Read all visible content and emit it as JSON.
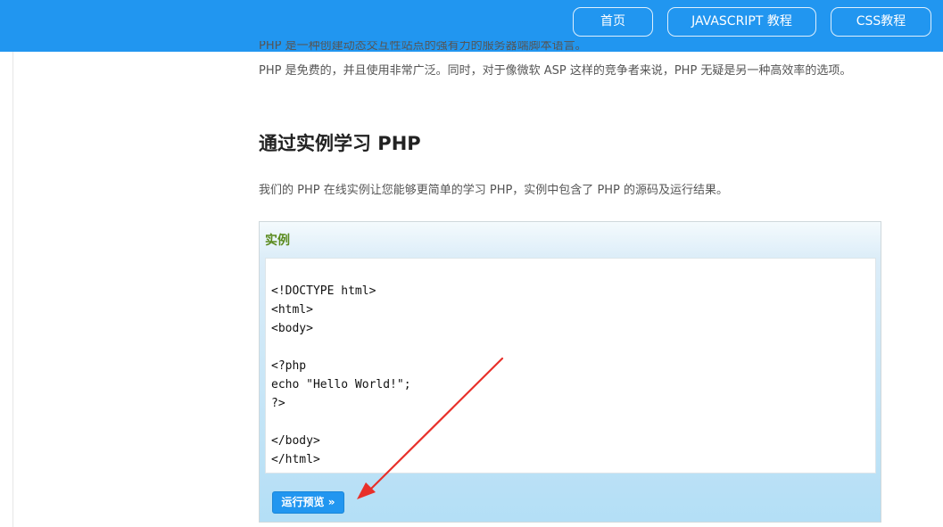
{
  "nav": {
    "home_label": "首页",
    "js_label": "JAVASCRIPT 教程",
    "css_label": "CSS教程"
  },
  "intro": {
    "cut_line": "PHP 是一种创建动态交互性站点的强有力的服务器端脚本语言。",
    "paragraph": "PHP 是免费的，并且使用非常广泛。同时，对于像微软 ASP 这样的竞争者来说，PHP 无疑是另一种高效率的选项。"
  },
  "section": {
    "title": "通过实例学习 PHP",
    "description": "我们的 PHP 在线实例让您能够更简单的学习 PHP，实例中包含了 PHP 的源码及运行结果。"
  },
  "example": {
    "label": "实例",
    "code_lines": [
      "<!DOCTYPE html>",
      "<html>",
      "<body>",
      "",
      "<?php",
      "echo \"Hello World!\";",
      "?>",
      "",
      "</body>",
      "</html>"
    ],
    "run_button_label": "运行预览 »"
  },
  "colors": {
    "topbar": "#2196f0",
    "example_label": "#5a8a1e",
    "annotation_arrow": "#e8302a"
  }
}
